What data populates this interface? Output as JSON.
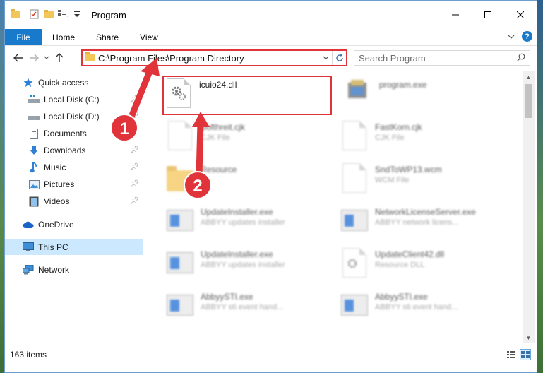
{
  "window": {
    "title": "Program"
  },
  "ribbon": {
    "file_tab": "File",
    "tabs": [
      "Home",
      "Share",
      "View"
    ],
    "help": "?"
  },
  "address": {
    "path": "C:\\Program Files\\Program Directory"
  },
  "search": {
    "placeholder": "Search Program"
  },
  "sidebar": {
    "items": [
      {
        "label": "Quick access",
        "icon": "star-icon"
      },
      {
        "label": "Local Disk (C:)",
        "icon": "drive-icon"
      },
      {
        "label": "Local Disk (D:)",
        "icon": "drive-icon"
      },
      {
        "label": "Documents",
        "icon": "documents-icon"
      },
      {
        "label": "Downloads",
        "icon": "download-icon"
      },
      {
        "label": "Music",
        "icon": "music-icon"
      },
      {
        "label": "Pictures",
        "icon": "pictures-icon"
      },
      {
        "label": "Videos",
        "icon": "videos-icon"
      },
      {
        "label": "OneDrive",
        "icon": "cloud-icon"
      },
      {
        "label": "This PC",
        "icon": "computer-icon"
      },
      {
        "label": "Network",
        "icon": "network-icon"
      }
    ]
  },
  "files": [
    {
      "name": "icuio24.dll",
      "type": "",
      "icon": "dll-gear-icon"
    },
    {
      "name": "program.exe",
      "type": "",
      "icon": "program-icon"
    },
    {
      "name": "Softhreit.cjk",
      "type": "CJK File",
      "icon": "document-icon"
    },
    {
      "name": "FastKorn.cjk",
      "type": "CJK File",
      "icon": "document-icon"
    },
    {
      "name": "Resource",
      "type": "",
      "icon": "folder-icon"
    },
    {
      "name": "SndToWP13.wcm",
      "type": "WCM File",
      "icon": "document-icon"
    },
    {
      "name": "UpdateInstaller.exe",
      "type": "ABBYY updates installer",
      "icon": "exe-icon"
    },
    {
      "name": "NetworkLicenseServer.exe",
      "type": "ABBYY network licens...",
      "icon": "exe-icon"
    },
    {
      "name": "UpdateInstaller.exe",
      "type": "ABBYY updates installer",
      "icon": "exe-icon"
    },
    {
      "name": "UpdateClient42.dll",
      "type": "Resource DLL",
      "icon": "dll-gear-icon"
    },
    {
      "name": "AbbyySTI.exe",
      "type": "ABBYY sti event hand...",
      "icon": "exe-icon"
    },
    {
      "name": "AbbyySTI.exe",
      "type": "ABBYY sti event hand...",
      "icon": "exe-icon"
    }
  ],
  "status": {
    "count": "163 items"
  },
  "annotations": {
    "step1": "1",
    "step2": "2"
  },
  "colors": {
    "accent": "#1979ca",
    "highlight": "#e0343a",
    "selected": "#cce8ff"
  }
}
